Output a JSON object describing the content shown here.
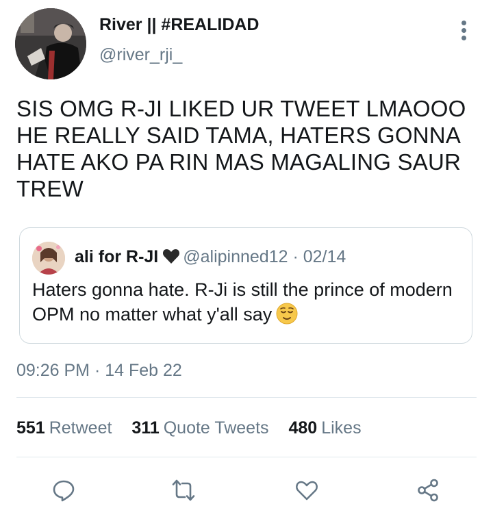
{
  "author": {
    "name": "River || #REALIDAD",
    "handle": "@river_rji_"
  },
  "tweet": {
    "text": "SIS OMG R-JI LIKED UR TWEET LMAOOO HE REALLY SAID TAMA, HATERS GONNA HATE AKO PA RIN MAS MAGALING SAUR TREW",
    "timestamp": "09:26 PM · 14 Feb 22"
  },
  "quoted_tweet": {
    "name": "ali for R-JI",
    "heart_icon": "black-heart-emoji",
    "meta": "@alipinned12 · 02/14",
    "text": "Haters gonna hate. R-Ji is still the prince of modern OPM no matter what y'all say",
    "emoji_icon": "relieved-face-emoji"
  },
  "stats": [
    {
      "count": "551",
      "label": "Retweet"
    },
    {
      "count": "311",
      "label": "Quote Tweets"
    },
    {
      "count": "480",
      "label": "Likes"
    }
  ],
  "actions": [
    "reply-icon",
    "retweet-icon",
    "like-icon",
    "share-icon"
  ],
  "colors": {
    "text": "#14171a",
    "secondary": "#657786",
    "border": "#cfd9de"
  }
}
